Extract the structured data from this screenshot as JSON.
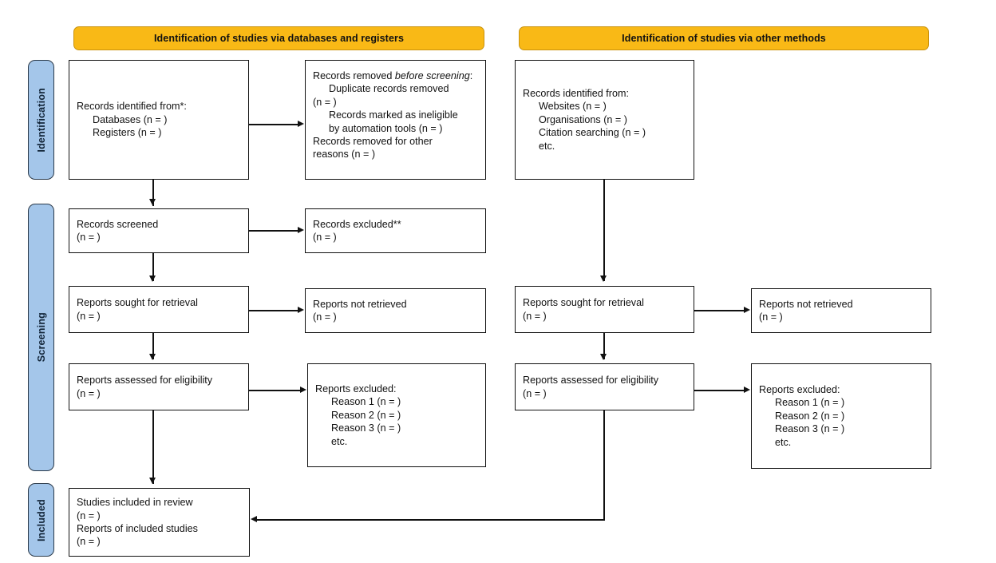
{
  "diagram": {
    "type": "PRISMA 2020 flow diagram",
    "colors": {
      "header_orange": "#f9b916",
      "stage_blue": "#a4c6ea",
      "box_border": "#111111"
    }
  },
  "headers": [
    {
      "id": "databases-registers",
      "label": "Identification of studies via databases and registers"
    },
    {
      "id": "other-methods",
      "label": "Identification of studies via other methods"
    }
  ],
  "stages": [
    {
      "id": "identification",
      "label": "Identification"
    },
    {
      "id": "screening",
      "label": "Screening"
    },
    {
      "id": "included",
      "label": "Included"
    }
  ],
  "boxes": {
    "records_identified": {
      "title": "Records identified from*:",
      "items": [
        "Databases (n = )",
        "Registers (n = )"
      ]
    },
    "records_removed": {
      "title_pre": "Records removed ",
      "title_italic": "before screening",
      "title_post": ":",
      "items": [
        "Duplicate records removed (n = )",
        "Records marked as ineligible by automation tools (n = )",
        "Records removed for other reasons (n = )"
      ],
      "lines": [
        "Duplicate records removed",
        "(n = )",
        "Records marked as ineligible",
        "by automation tools (n = )",
        "Records removed for other",
        "reasons (n = )"
      ]
    },
    "records_screened": {
      "title": "Records screened",
      "count": "(n = )"
    },
    "records_excluded": {
      "title": "Records excluded**",
      "count": "(n = )"
    },
    "reports_sought_left": {
      "title": "Reports sought for retrieval",
      "count": "(n = )"
    },
    "reports_not_retrieved_left": {
      "title": "Reports not retrieved",
      "count": "(n = )"
    },
    "reports_assessed_left": {
      "title": "Reports assessed for eligibility",
      "count": "(n = )"
    },
    "reports_excluded_left": {
      "title": "Reports excluded:",
      "items": [
        "Reason 1 (n = )",
        "Reason 2 (n = )",
        "Reason 3 (n = )",
        "etc."
      ]
    },
    "records_identified_other": {
      "title": "Records identified from:",
      "items": [
        "Websites (n = )",
        "Organisations (n = )",
        "Citation searching (n = )",
        "etc."
      ]
    },
    "reports_sought_right": {
      "title": "Reports sought for retrieval",
      "count": "(n = )"
    },
    "reports_not_retrieved_right": {
      "title": "Reports not retrieved",
      "count": "(n = )"
    },
    "reports_assessed_right": {
      "title": "Reports assessed for eligibility",
      "count": "(n = )"
    },
    "reports_excluded_right": {
      "title": "Reports excluded:",
      "items": [
        "Reason 1 (n = )",
        "Reason 2 (n = )",
        "Reason 3 (n = )",
        "etc."
      ]
    },
    "studies_included": {
      "line1": "Studies included in review",
      "line2": "(n = )",
      "line3": "Reports of included studies",
      "line4": "(n = )"
    }
  }
}
